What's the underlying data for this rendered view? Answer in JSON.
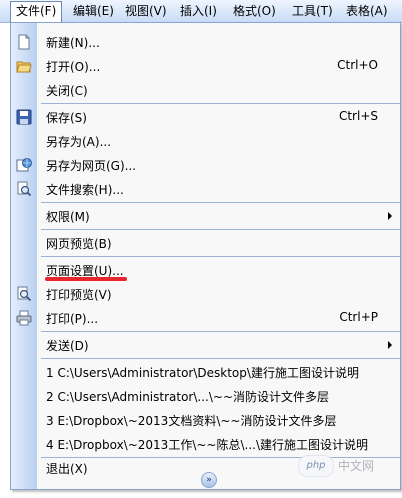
{
  "menubar": {
    "items": [
      "文件(F)",
      "编辑(E)",
      "视图(V)",
      "插入(I)",
      "格式(O)",
      "工具(T)",
      "表格(A)"
    ]
  },
  "menu": {
    "new": "新建(N)...",
    "open": "打开(O)...",
    "open_shortcut": "Ctrl+O",
    "close": "关闭(C)",
    "save": "保存(S)",
    "save_shortcut": "Ctrl+S",
    "save_as": "另存为(A)...",
    "save_as_web": "另存为网页(G)...",
    "file_search": "文件搜索(H)...",
    "permission": "权限(M)",
    "web_preview": "网页预览(B)",
    "page_setup": "页面设置(U)...",
    "print_preview": "打印预览(V)",
    "print": "打印(P)...",
    "print_shortcut": "Ctrl+P",
    "send": "发送(D)",
    "recent1": "1 C:\\Users\\Administrator\\Desktop\\建行施工图设计说明",
    "recent2": "2 C:\\Users\\Administrator\\...\\~~消防设计文件多层",
    "recent3": "3 E:\\Dropbox\\~2013文档资料\\~~消防设计文件多层",
    "recent4": "4 E:\\Dropbox\\~2013工作\\~~陈总\\...\\建行施工图设计说明",
    "exit": "退出(X)",
    "expand": "»"
  },
  "watermark": {
    "logo": "php",
    "text": "中文网"
  },
  "colors": {
    "highlight_underline": "#e8262d",
    "gutter": "#b9d0f0"
  }
}
